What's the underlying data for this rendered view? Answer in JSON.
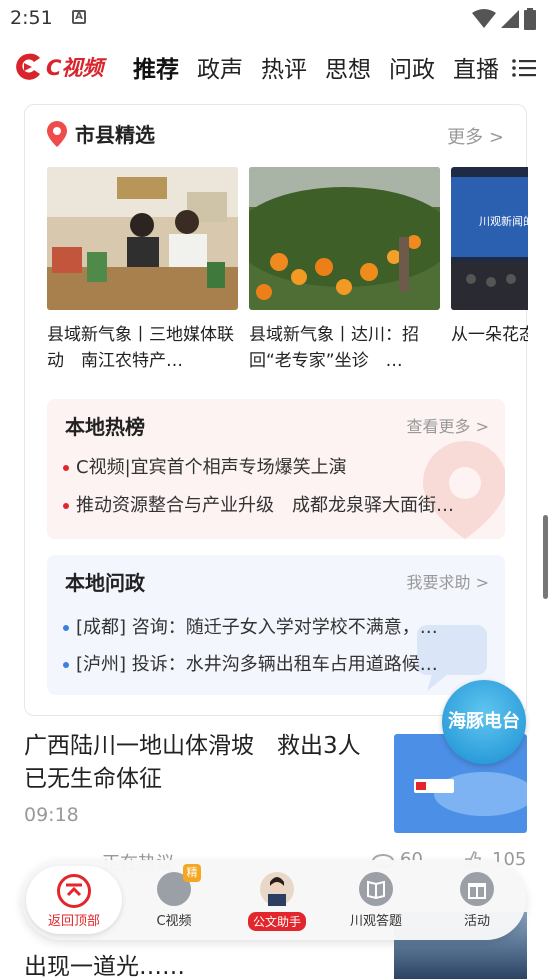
{
  "status_bar": {
    "time": "2:51",
    "notification_icon": "A"
  },
  "app": {
    "logo_text": "C视频"
  },
  "nav": {
    "tabs": [
      "推荐",
      "政声",
      "热评",
      "思想",
      "问政",
      "直播"
    ],
    "active_index": 0
  },
  "county_section": {
    "title": "市县精选",
    "more": "更多 >",
    "items": [
      {
        "caption": "县域新气象丨三地媒体联动　南江农特产…"
      },
      {
        "caption": "县域新气象丨达川：招回“老专家”坐诊　…"
      },
      {
        "caption": "从一朵花态，“川"
      }
    ],
    "banner_text": "川观新闻的子花"
  },
  "hot_list": {
    "title": "本地热榜",
    "more": "查看更多 >",
    "items": [
      "C视频|宜宾首个相声专场爆笑上演",
      "推动资源整合与产业升级　成都龙泉驿大面街…"
    ]
  },
  "local_ask": {
    "title": "本地问政",
    "more": "我要求助 >",
    "items": [
      "[成都] 咨询：随迁子女入学对学校不满意，…",
      "[泸州] 投诉：水井沟多辆出租车占用道路候…"
    ]
  },
  "float_button": {
    "label": "海豚电台"
  },
  "news": [
    {
      "title": "广西陆川一地山体滑坡　救出3人已无生命体征",
      "time": "09:18",
      "source": "正在热议",
      "views": "60",
      "likes": "105"
    },
    {
      "title": "出现一道光……"
    }
  ],
  "bottom_bar": {
    "items": [
      {
        "label": "返回顶部"
      },
      {
        "label": "C视频",
        "badge": "精"
      },
      {
        "label": "公文助手"
      },
      {
        "label": "川观答题"
      },
      {
        "label": "活动"
      }
    ]
  },
  "colors": {
    "accent": "#e2262b",
    "logo_red": "#d9242b",
    "hot_bg": "#fdf3f2",
    "ask_bg": "#f3f6fd",
    "dolphin": "#1b8ed3"
  }
}
